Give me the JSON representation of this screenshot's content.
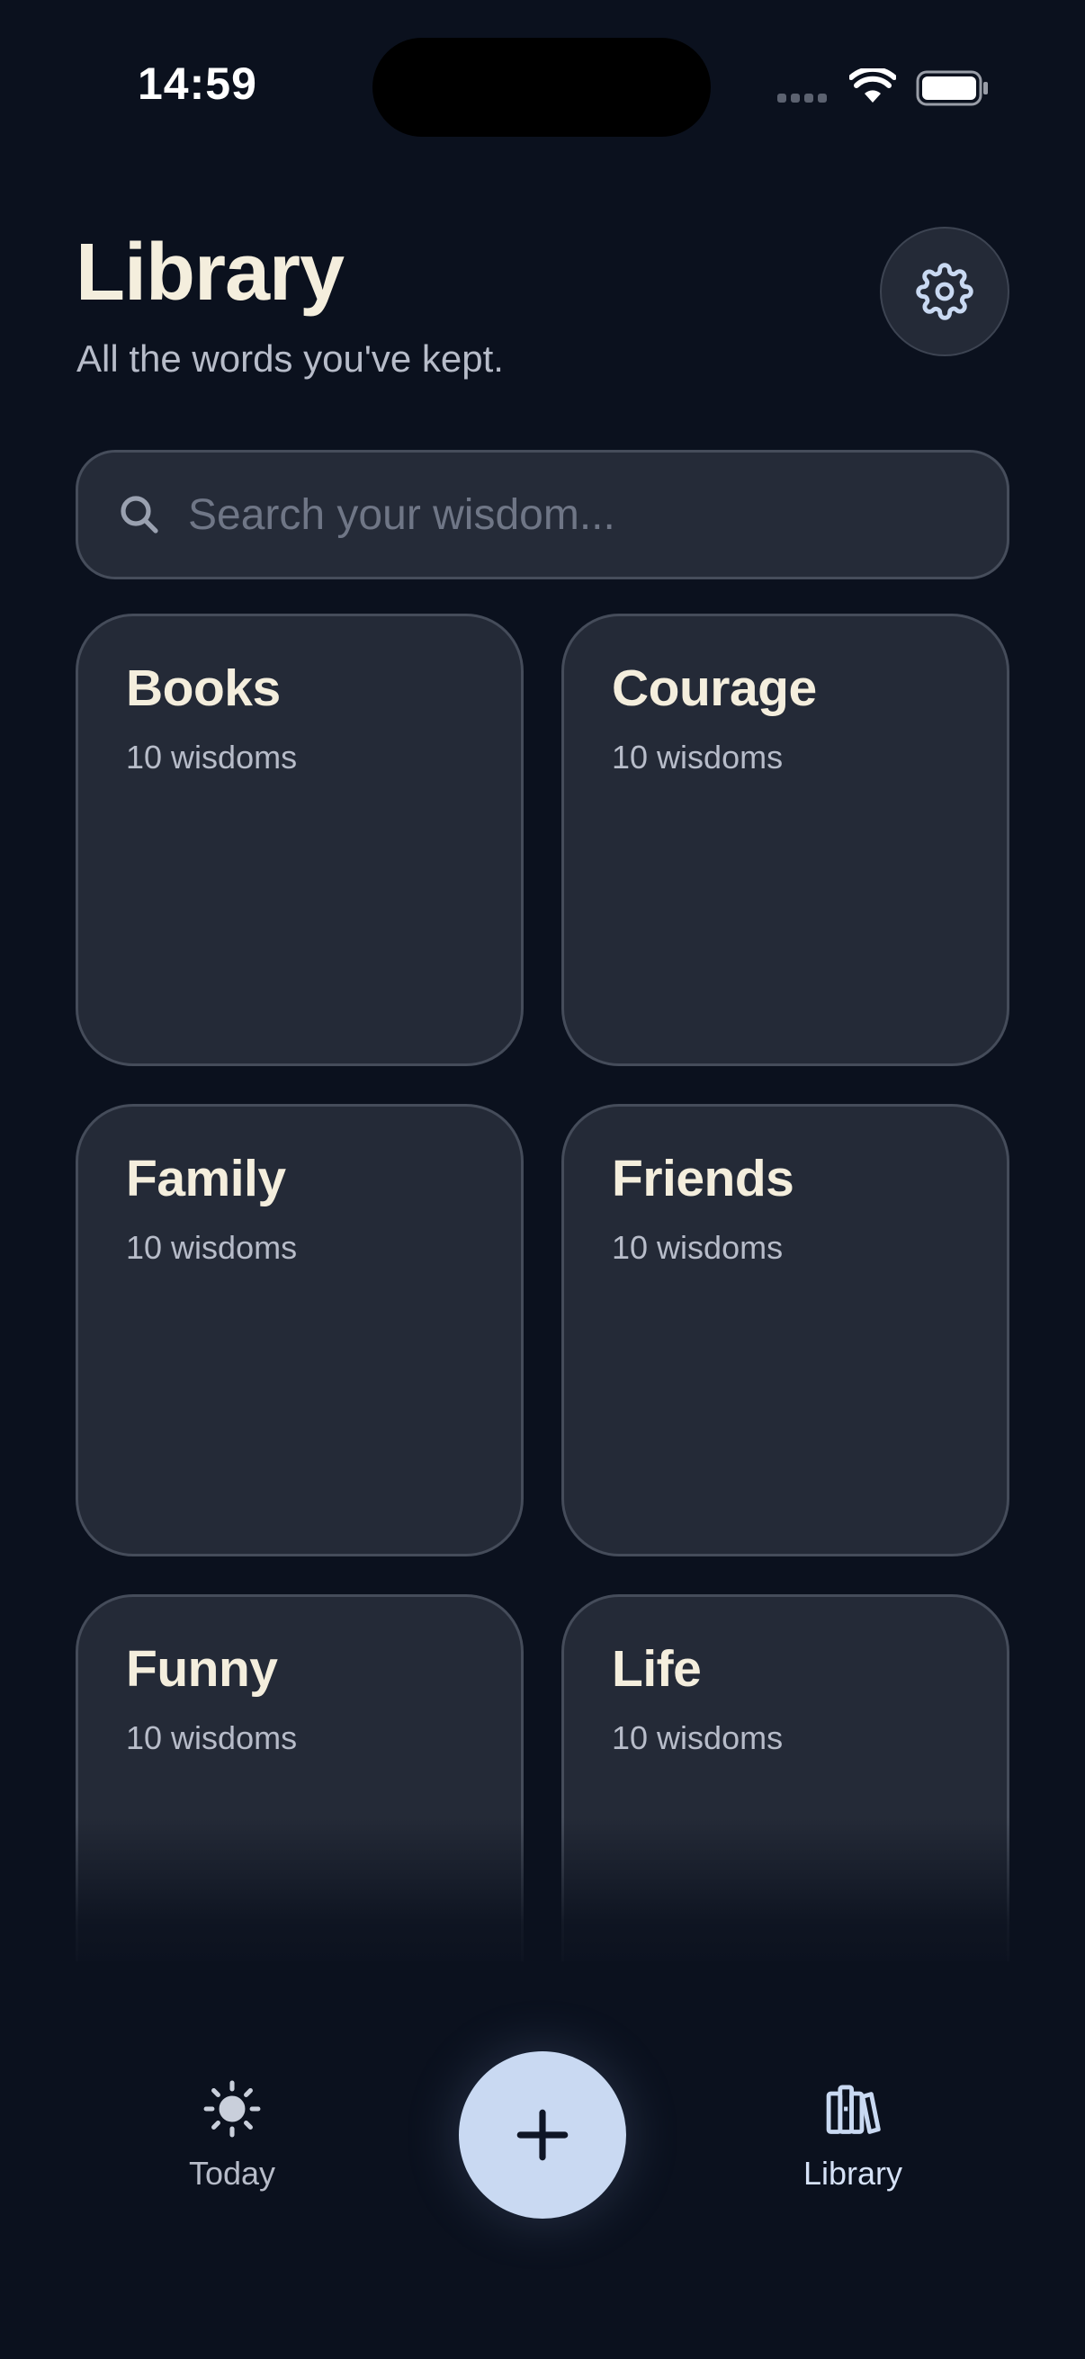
{
  "status_bar": {
    "time": "14:59"
  },
  "header": {
    "title": "Library",
    "subtitle": "All the words you've kept.",
    "settings_icon": "gear-icon"
  },
  "search": {
    "placeholder": "Search your wisdom...",
    "value": "",
    "icon": "search-icon"
  },
  "categories": [
    {
      "name": "Books",
      "count": "10 wisdoms"
    },
    {
      "name": "Courage",
      "count": "10 wisdoms"
    },
    {
      "name": "Family",
      "count": "10 wisdoms"
    },
    {
      "name": "Friends",
      "count": "10 wisdoms"
    },
    {
      "name": "Funny",
      "count": "10 wisdoms"
    },
    {
      "name": "Life",
      "count": "10 wisdoms"
    }
  ],
  "tabbar": {
    "today_label": "Today",
    "today_icon": "sun-icon",
    "add_icon": "plus-icon",
    "library_label": "Library",
    "library_icon": "books-icon",
    "active_tab": "Library"
  },
  "colors": {
    "background": "#0b111e",
    "card": "#242a37",
    "title_text": "#f4eedd",
    "accent": "#c9d9f2"
  }
}
